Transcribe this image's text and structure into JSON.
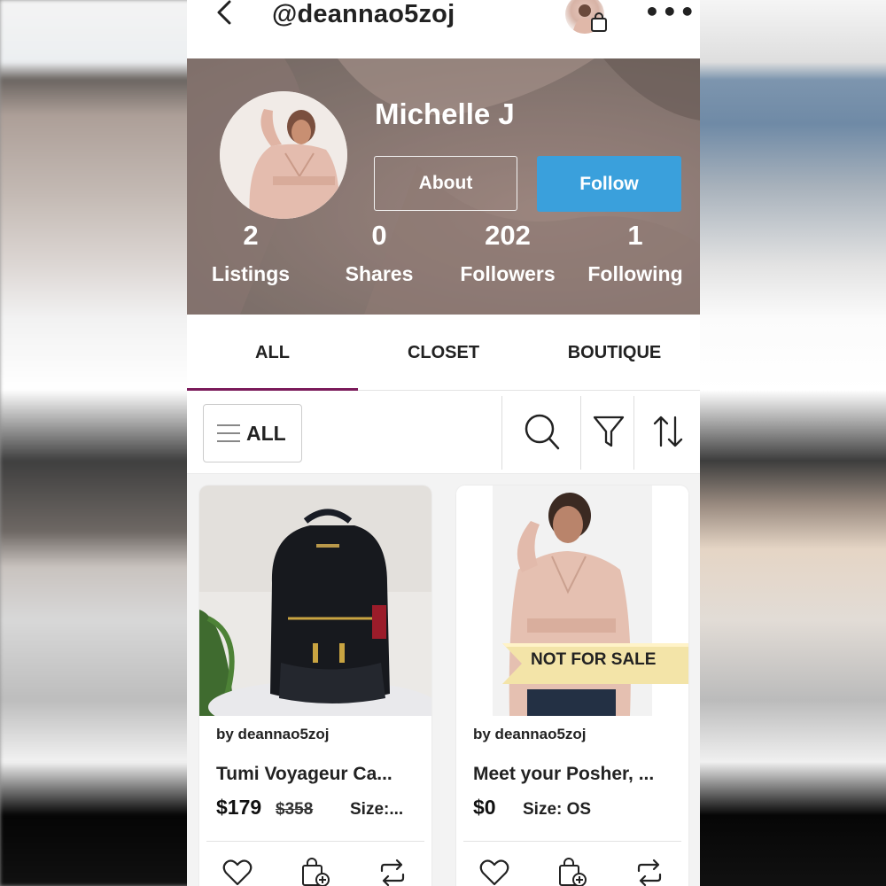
{
  "topbar": {
    "handle": "@deannao5zoj",
    "icons": [
      "back-chevron-icon",
      "shopping-bag-icon",
      "more-dots-icon"
    ],
    "more_label": "•••"
  },
  "profile": {
    "name": "Michelle J",
    "about_label": "About",
    "follow_label": "Follow",
    "follow_color": "#3aa0dc",
    "stats": [
      {
        "value": "2",
        "label": "Listings"
      },
      {
        "value": "0",
        "label": "Shares"
      },
      {
        "value": "202",
        "label": "Followers"
      },
      {
        "value": "1",
        "label": "Following"
      }
    ]
  },
  "tabs": [
    {
      "label": "ALL",
      "active": true
    },
    {
      "label": "CLOSET",
      "active": false
    },
    {
      "label": "BOUTIQUE",
      "active": false
    }
  ],
  "tab_accent": "#7a1a5a",
  "toolbar": {
    "filter_label": "ALL",
    "icons": [
      "menu-lines-icon",
      "search-icon",
      "filter-funnel-icon",
      "sort-arrows-icon"
    ]
  },
  "listings": [
    {
      "byline": "by deannao5zoj",
      "title": "Tumi Voyageur Ca...",
      "price": "$179",
      "original_price": "$358",
      "size": "Size:...",
      "image": "black-backpack-photo"
    },
    {
      "byline": "by deannao5zoj",
      "title": "Meet your Posher, ...",
      "price": "$0",
      "size": "Size: OS",
      "badge": "NOT FOR SALE",
      "image": "woman-pink-blouse-photo"
    }
  ]
}
